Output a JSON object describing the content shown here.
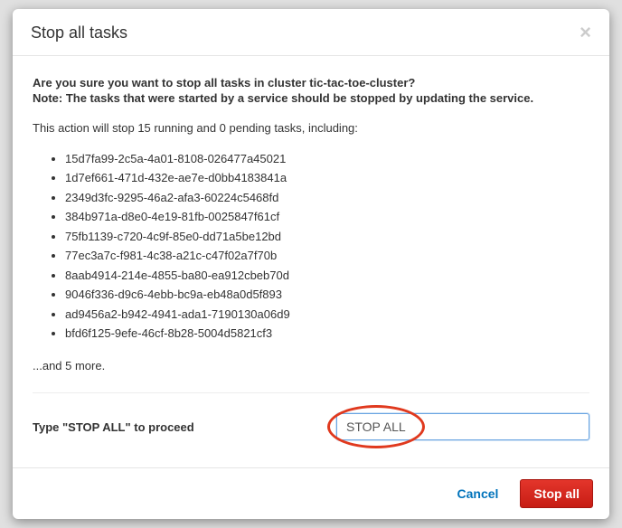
{
  "modal": {
    "title": "Stop all tasks",
    "confirm_question": "Are you sure you want to stop all tasks in cluster tic-tac-toe-cluster?",
    "note": "Note: The tasks that were started by a service should be stopped by updating the service.",
    "action_description": "This action will stop 15 running and 0 pending tasks, including:",
    "tasks": [
      "15d7fa99-2c5a-4a01-8108-026477a45021",
      "1d7ef661-471d-432e-ae7e-d0bb4183841a",
      "2349d3fc-9295-46a2-afa3-60224c5468fd",
      "384b971a-d8e0-4e19-81fb-0025847f61cf",
      "75fb1139-c720-4c9f-85e0-dd71a5be12bd",
      "77ec3a7c-f981-4c38-a21c-c47f02a7f70b",
      "8aab4914-214e-4855-ba80-ea912cbeb70d",
      "9046f336-d9c6-4ebb-bc9a-eb48a0d5f893",
      "ad9456a2-b942-4941-ada1-7190130a06d9",
      "bfd6f125-9efe-46cf-8b28-5004d5821cf3"
    ],
    "more_text": "...and 5 more.",
    "confirm_label": "Type \"STOP ALL\" to proceed",
    "confirm_input_value": "STOP ALL",
    "cancel_label": "Cancel",
    "stop_label": "Stop all"
  }
}
